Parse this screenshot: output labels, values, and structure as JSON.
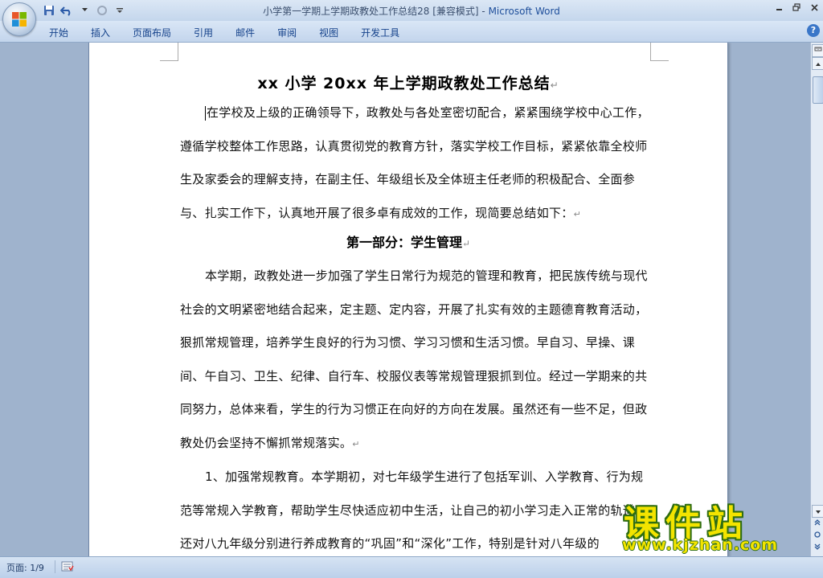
{
  "window": {
    "title_doc": "小学第一学期上学期政教处工作总结28 [兼容模式] - ",
    "title_app": "Microsoft Word"
  },
  "ribbon": {
    "tabs": [
      "开始",
      "插入",
      "页面布局",
      "引用",
      "邮件",
      "审阅",
      "视图",
      "开发工具"
    ],
    "help_label": "?"
  },
  "document": {
    "title": "xx 小学 20xx 年上学期政教处工作总结",
    "para1": "在学校及上级的正确领导下，政教处与各处室密切配合，紧紧围绕学校中心工作，遵循学校整体工作思路，认真贯彻党的教育方针，落实学校工作目标，紧紧依靠全校师生及家委会的理解支持，在副主任、年级组长及全体班主任老师的积极配合、全面参与、扎实工作下，认真地开展了很多卓有成效的工作，现简要总结如下：",
    "section1_title": "第一部分：学生管理",
    "para2": "本学期，政教处进一步加强了学生日常行为规范的管理和教育，把民族传统与现代社会的文明紧密地结合起来，定主题、定内容，开展了扎实有效的主题德育教育活动，狠抓常规管理，培养学生良好的行为习惯、学习习惯和生活习惯。早自习、早操、课间、午自习、卫生、纪律、自行车、校服仪表等常规管理狠抓到位。经过一学期来的共同努力，总体来看，学生的行为习惯正在向好的方向在发展。虽然还有一些不足，但政教处仍会坚持不懈抓常规落实。",
    "para3": "1、加强常规教育。本学期初，对七年级学生进行了包括军训、入学教育、行为规范等常规入学教育，帮助学生尽快适应初中生活，让自己的初小学习走入正常的轨道。还对八九年级分别进行养成教育的“巩固”和“深化”工作，特别是针对八年级的",
    "para_mark": "↵"
  },
  "watermark": {
    "text_cn": "课件站",
    "url": "www.kjzhan.com"
  },
  "status": {
    "page": "页面: 1/9"
  },
  "colors": {
    "ribbon_text": "#15428b",
    "app_title": "#1f4f9b",
    "watermark_fill": "#f3e400",
    "watermark_outline": "#2f6d12"
  }
}
